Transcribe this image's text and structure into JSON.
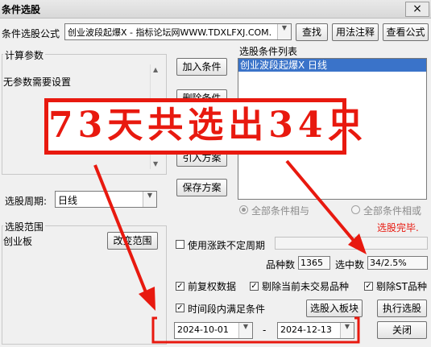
{
  "window": {
    "title": "条件选股",
    "close_glyph": "×"
  },
  "formula": {
    "label": "条件选股公式",
    "value": "创业波段起爆X  -  指标论坛网WWW.TDXLFXJ.COM.",
    "find_btn": "查找",
    "usage_btn": "用法注释",
    "view_btn": "查看公式"
  },
  "params": {
    "legend": "计算参数",
    "text": "无参数需要设置"
  },
  "side_buttons": {
    "add": "加入条件",
    "delete": "删除条件",
    "import": "引入方案",
    "save": "保存方案"
  },
  "condition_list": {
    "label": "选股条件列表",
    "items": [
      "创业波段起爆X  日线"
    ]
  },
  "period": {
    "label": "选股周期:",
    "value": "日线"
  },
  "logic": {
    "and_label": "全部条件相与",
    "or_label": "全部条件相或",
    "and_selected": true
  },
  "status_text": "选股完毕.",
  "range": {
    "legend": "选股范围",
    "value": "创业板",
    "change_btn": "改变范围"
  },
  "options": {
    "variable_period": "使用涨跌不定周期",
    "variable_period_checked": false,
    "forward_adjust": "前复权数据",
    "forward_adjust_checked": true,
    "exclude_untraded": "剔除当前未交易品种",
    "exclude_untraded_checked": true,
    "exclude_st": "剔除ST品种",
    "exclude_st_checked": true,
    "time_segment": "时间段内满足条件",
    "time_segment_checked": true
  },
  "stats": {
    "total_label": "品种数",
    "total_value": "1365",
    "selected_label": "选中数",
    "selected_value": "34/2.5%"
  },
  "bottom_buttons": {
    "to_block": "选股入板块",
    "execute": "执行选股",
    "close": "关闭"
  },
  "dates": {
    "from": "2024-10-01",
    "separator": "-",
    "to": "2024-12-13"
  },
  "overlay": {
    "text": "73天共选出34只",
    "color": "#e8190f"
  },
  "icons": {
    "dropdown": "chevron-down-icon",
    "check": "checkmark-icon"
  }
}
